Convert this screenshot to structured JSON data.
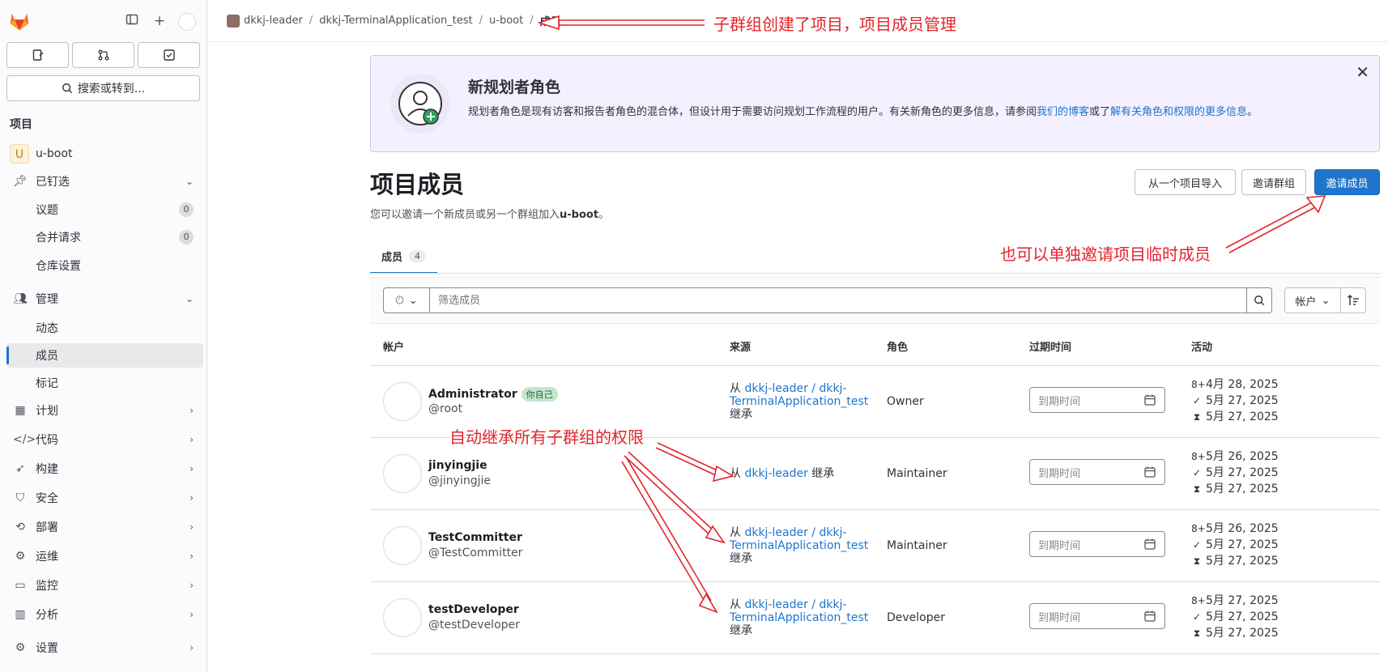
{
  "sidebar": {
    "search_label": "搜索或转到...",
    "section_title": "项目",
    "project": {
      "avatar_letter": "U",
      "name": "u-boot"
    },
    "pinned": {
      "label": "已钉选",
      "items": [
        {
          "label": "议题",
          "count": "0"
        },
        {
          "label": "合并请求",
          "count": "0"
        },
        {
          "label": "仓库设置"
        }
      ]
    },
    "manage": {
      "label": "管理",
      "items": [
        {
          "label": "动态"
        },
        {
          "label": "成员"
        },
        {
          "label": "标记"
        }
      ]
    },
    "nav": [
      {
        "label": "计划",
        "icon": "calendar-icon"
      },
      {
        "label": "代码",
        "icon": "code-icon"
      },
      {
        "label": "构建",
        "icon": "rocket-icon"
      },
      {
        "label": "安全",
        "icon": "shield-icon"
      },
      {
        "label": "部署",
        "icon": "deploy-icon"
      },
      {
        "label": "运维",
        "icon": "cloud-gear-icon"
      },
      {
        "label": "监控",
        "icon": "monitor-icon"
      },
      {
        "label": "分析",
        "icon": "chart-icon"
      },
      {
        "label": "设置",
        "icon": "gear-icon"
      }
    ]
  },
  "breadcrumb": {
    "items": [
      "dkkj-leader",
      "dkkj-TerminalApplication_test",
      "u-boot"
    ],
    "current": "成员"
  },
  "banner": {
    "title": "新规划者角色",
    "text": "规划者角色是现有访客和报告者角色的混合体，但设计用于需要访问规划工作流程的用户。有关新角色的更多信息，请参阅",
    "link1": "我们的博客",
    "mid": "或了",
    "link2": "解有关角色和权限的更多信息",
    "end": "。"
  },
  "page": {
    "title": "项目成员",
    "subtitle_pre": "您可以邀请一个新成员或另一个群组加入",
    "subtitle_project": "u-boot",
    "subtitle_post": "。",
    "import_button": "从一个项目导入",
    "invite_group_button": "邀请群组",
    "invite_member_button": "邀请成员"
  },
  "tabs": {
    "members_label": "成员",
    "members_count": "4"
  },
  "filter": {
    "placeholder": "筛选成员",
    "sort_label": "帐户"
  },
  "table": {
    "headers": [
      "帐户",
      "来源",
      "角色",
      "过期时间",
      "活动"
    ],
    "expiry_placeholder": "到期时间",
    "you_badge": "你自己",
    "rows": [
      {
        "name": "Administrator",
        "username": "@root",
        "you": true,
        "source_prefix": "从",
        "source_link": "dkkj-leader / dkkj-TerminalApplication_test",
        "source_suffix": "继承",
        "role": "Owner",
        "activity": [
          "4月 28, 2025",
          "5月 27, 2025",
          "5月 27, 2025"
        ]
      },
      {
        "name": "jinyingjie",
        "username": "@jinyingjie",
        "you": false,
        "source_prefix": "从",
        "source_link": "dkkj-leader",
        "source_suffix": "继承",
        "role": "Maintainer",
        "activity": [
          "5月 26, 2025",
          "5月 27, 2025",
          "5月 27, 2025"
        ]
      },
      {
        "name": "TestCommitter",
        "username": "@TestCommitter",
        "you": false,
        "source_prefix": "从",
        "source_link": "dkkj-leader / dkkj-TerminalApplication_test",
        "source_suffix": "继承",
        "role": "Maintainer",
        "activity": [
          "5月 26, 2025",
          "5月 27, 2025",
          "5月 27, 2025"
        ]
      },
      {
        "name": "testDeveloper",
        "username": "@testDeveloper",
        "you": false,
        "source_prefix": "从",
        "source_link": "dkkj-leader / dkkj-TerminalApplication_test",
        "source_suffix": "继承",
        "role": "Developer",
        "activity": [
          "5月 27, 2025",
          "5月 27, 2025",
          "5月 27, 2025"
        ]
      }
    ]
  },
  "annotations": {
    "top": "子群组创建了项目，项目成员管理",
    "invite": "也可以单独邀请项目临时成员",
    "inherit": "自动继承所有子群组的权限"
  },
  "colors": {
    "accent": "#1f75cb",
    "annotation": "#e3242b",
    "banner_bg": "#f4f0ff"
  }
}
